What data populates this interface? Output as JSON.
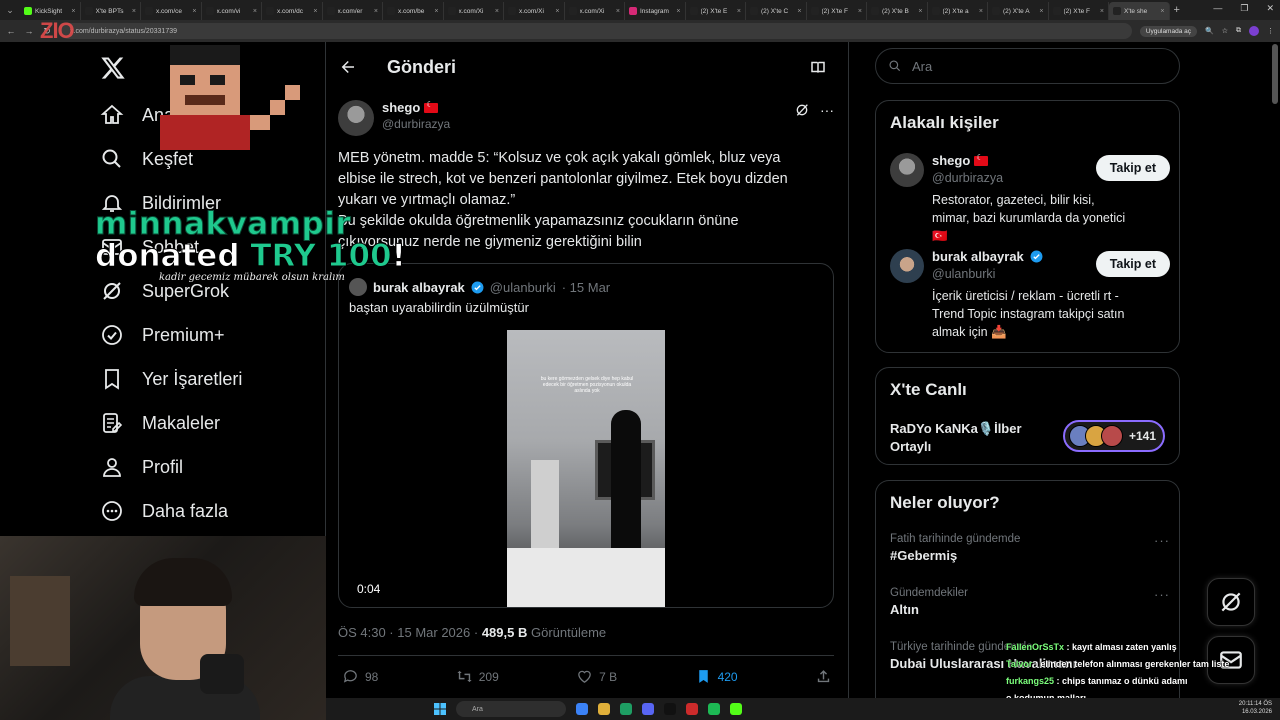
{
  "browser": {
    "tabs": [
      {
        "label": "KickSight",
        "color": "#53fc18"
      },
      {
        "label": "X'te BPTs",
        "color": "#222222"
      },
      {
        "label": "x.com/ce",
        "color": "#222222"
      },
      {
        "label": "x.com/vi",
        "color": "#222222"
      },
      {
        "label": "x.com/dc",
        "color": "#222222"
      },
      {
        "label": "x.com/er",
        "color": "#222222"
      },
      {
        "label": "x.com/be",
        "color": "#222222"
      },
      {
        "label": "x.com/Xi",
        "color": "#222222"
      },
      {
        "label": "x.com/Xi",
        "color": "#222222"
      },
      {
        "label": "x.com/Xi",
        "color": "#222222"
      },
      {
        "label": "Instagram",
        "color": "#d62976"
      },
      {
        "label": "(2) X'te E",
        "color": "#222222"
      },
      {
        "label": "(2) X'te C",
        "color": "#222222"
      },
      {
        "label": "(2) X'te F",
        "color": "#222222"
      },
      {
        "label": "(2) X'te B",
        "color": "#222222"
      },
      {
        "label": "(2) X'te a",
        "color": "#222222"
      },
      {
        "label": "(2) X'te A",
        "color": "#222222"
      },
      {
        "label": "(2) X'te F",
        "color": "#222222"
      },
      {
        "label": "X'te she",
        "color": "#222222",
        "active": true
      }
    ],
    "url": "x.com/durbirazya/status/20331739",
    "app_badge": "Uygulamada aç"
  },
  "stream": {
    "logo": "ZIO",
    "donation": {
      "name": "minnakvampir",
      "prefix": "donated",
      "amount": "TRY 100",
      "suffix": "!",
      "message": "kadir gecemiz mübarek olsun kralım"
    },
    "chat": [
      {
        "user": "FallenOrSsTx",
        "text": "kayıt alması zaten yanlış"
      },
      {
        "user": "Talvor",
        "text": "elinden telefon alınması gerekenler tam liste"
      },
      {
        "user": "furkangs25",
        "text": "chips tanımaz o dünkü adamı"
      },
      {
        "user": "",
        "text": "o kodumun malları"
      }
    ]
  },
  "leftnav": {
    "items": [
      {
        "key": "home",
        "label": "Anasayfa",
        "icon": "home-icon"
      },
      {
        "key": "explore",
        "label": "Keşfet",
        "icon": "search-icon"
      },
      {
        "key": "notifications",
        "label": "Bildirimler",
        "icon": "bell-icon"
      },
      {
        "key": "chat",
        "label": "Sohbet",
        "icon": "mail-icon"
      },
      {
        "key": "grok",
        "label": "SuperGrok",
        "icon": "grok-icon"
      },
      {
        "key": "premium",
        "label": "Premium+",
        "icon": "verified-badge-icon"
      },
      {
        "key": "bookmarks",
        "label": "Yer İşaretleri",
        "icon": "bookmark-icon"
      },
      {
        "key": "articles",
        "label": "Makaleler",
        "icon": "articles-icon"
      },
      {
        "key": "profile",
        "label": "Profil",
        "icon": "person-icon"
      },
      {
        "key": "more",
        "label": "Daha fazla",
        "icon": "more-circle-icon"
      }
    ]
  },
  "post": {
    "header_title": "Gönderi",
    "author_name": "shego",
    "author_handle": "@durbirazya",
    "text_lines": [
      "MEB yönetm. madde 5: “Kolsuz ve çok açık yakalı gömlek, bluz veya",
      "elbise ile strech, kot ve benzeri pantolonlar giyilmez. Etek boyu dizden",
      "yukarı ve yırtmaçlı olamaz.”",
      "Bu şekilde okulda öğretmenlik yapamazsınız çocukların önüne",
      "çıkıyorsunuz nerde ne giymeniz gerektiğini bilin"
    ],
    "quote": {
      "name": "burak albayrak",
      "handle": "@ulanburki",
      "date": "· 15 Mar",
      "text": "baştan uyarabilirdin üzülmüştür",
      "video_time": "0:04",
      "video_caption": "bu kere görmezden gelsek diye hep kabul edecek bir öğretmen pozisyonun okulda aslında yok"
    },
    "time": "ÖS 4:30 · 15 Mar 2026 ·",
    "views_value": "489,5 B",
    "views_label": "Görüntüleme",
    "stats": {
      "replies": "98",
      "reposts": "209",
      "likes": "7 B",
      "bookmarks": "420"
    }
  },
  "right": {
    "search_placeholder": "Ara",
    "related": {
      "title": "Alakalı kişiler",
      "people": [
        {
          "name": "shego",
          "handle": "@durbirazya",
          "bio": "Restorator, gazeteci, bilir kisi, mimar, bazi kurumlarda da yonetici 🇹🇷",
          "follow": "Takip et",
          "flag": true,
          "verified": false
        },
        {
          "name": "burak albayrak",
          "handle": "@ulanburki",
          "bio": "İçerik üreticisi / reklam - ücretli rt - Trend Topic instagram takipçi satın almak için 📥",
          "follow": "Takip et",
          "flag": false,
          "verified": true
        }
      ]
    },
    "live": {
      "title": "X'te Canlı",
      "space_name": "RaDYo KaNKa🎙️İlber Ortaylı",
      "count": "+141"
    },
    "trends": {
      "title": "Neler oluyor?",
      "items": [
        {
          "meta": "Fatih tarihinde gündemde",
          "name": "#Gebermiş"
        },
        {
          "meta": "Gündemdekiler",
          "name": "Altın"
        },
        {
          "meta": "Türkiye tarihinde gündemde",
          "name": "Dubai Uluslararası Havalimanı"
        }
      ]
    }
  },
  "taskbar": {
    "search": "Ara",
    "time": "20:11:14 ÖS",
    "date": "16.03.2026"
  }
}
